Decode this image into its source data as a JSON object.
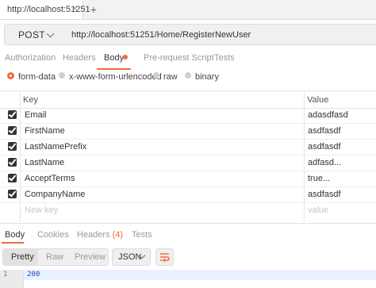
{
  "tab": {
    "title": "http://localhost:51251",
    "close": "×",
    "new_tab": "+"
  },
  "request": {
    "method": "POST",
    "url": "http://localhost:51251/Home/RegisterNewUser"
  },
  "request_tabs": [
    "Authorization",
    "Headers",
    "Body",
    "Pre-request Script",
    "Tests"
  ],
  "active_request_tab": "Body",
  "body_types": [
    "form-data",
    "x-www-form-urlencoded",
    "raw",
    "binary"
  ],
  "selected_body_type": "form-data",
  "table": {
    "key_header": "Key",
    "value_header": "Value",
    "rows": [
      {
        "key": "Email",
        "value": "adasdfasd",
        "checked": true
      },
      {
        "key": "FirstName",
        "value": "asdfasdf",
        "checked": true
      },
      {
        "key": "LastNamePrefix",
        "value": "asdfasdf",
        "checked": true
      },
      {
        "key": "LastName",
        "value": "adfasd...",
        "checked": true
      },
      {
        "key": "AcceptTerms",
        "value": "true...",
        "checked": true
      },
      {
        "key": "CompanyName",
        "value": "asdfasdf",
        "checked": true
      }
    ],
    "new_key_placeholder": "New key",
    "new_value_placeholder": "value"
  },
  "response": {
    "tabs": [
      "Body",
      "Cookies",
      "Headers",
      "Tests"
    ],
    "headers_count": "(4)",
    "active_tab": "Body",
    "formats": [
      "Pretty",
      "Raw",
      "Preview"
    ],
    "active_format": "Pretty",
    "language": "JSON",
    "line_number": "1",
    "code": "200"
  },
  "colors": {
    "accent": "#f26b3a",
    "code_number": "#1f3fd1"
  },
  "icons": {
    "wrap": "wrap-lines-icon",
    "chevron": "chevron-down-icon",
    "checkbox": "checkbox-checked-icon"
  }
}
